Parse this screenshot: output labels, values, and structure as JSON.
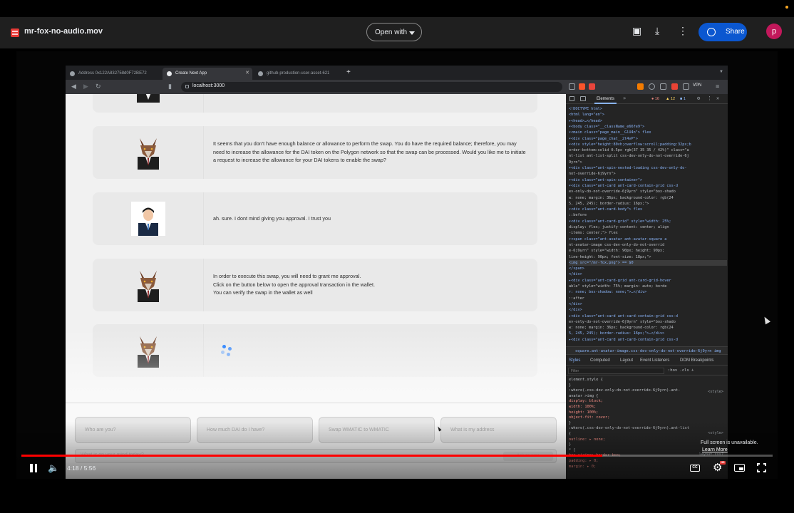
{
  "topbar": {
    "file_name": "mr-fox-no-audio.mov",
    "open_with_label": "Open with",
    "share_label": "Share",
    "avatar_letter": "p"
  },
  "browser": {
    "tabs": [
      {
        "label": "Address 0x122A832758d0F72BE72",
        "active": false
      },
      {
        "label": "Create Next App",
        "active": true
      },
      {
        "label": "github-production-user-asset-621",
        "active": false
      }
    ],
    "new_tab_label": "+",
    "url": "localhost:3000",
    "vpn_label": "VPN"
  },
  "chat": {
    "messages": [
      {
        "role": "assistant",
        "avatar": "fox-avatar",
        "text": ""
      },
      {
        "role": "assistant",
        "avatar": "fox-avatar",
        "text": "It seems that you don't have enough balance or allowance to perform the swap. You do have the required balance; therefore, you may need to increase the allowance for the DAI token on the Polygon network so that the swap can be processed. Would you like me to initiate a request to increase the allowance for your DAI tokens to enable the swap?"
      },
      {
        "role": "user",
        "avatar": "user-avatar",
        "text": "ah. sure. I dont mind giving you approval. I trust you"
      },
      {
        "role": "assistant",
        "avatar": "fox-avatar",
        "text": "In order to execute this swap, you will need to grant me approval.\nClick on the button below to open the approval transaction in the wallet.\nYou can verify the swap in the wallet as well"
      },
      {
        "role": "assistant",
        "avatar": "fox-avatar",
        "text": "",
        "loading": true
      }
    ],
    "suggestions": [
      "Who are you?",
      "How much DAI do I have?",
      "Swap WMATIC to WMATIC",
      "What is my address"
    ],
    "input_placeholder": "What is on your mind today?",
    "send_label": "Ask an area"
  },
  "devtools": {
    "tab_elements": "Elements",
    "errors": "16",
    "warnings": "12",
    "info": "1",
    "dom_lines": [
      "<!DOCTYPE html>",
      "<html lang=\"en\">",
      "▸<head>…</head>",
      "▾<body class=\"__className_e66fe9\">",
      "  ▾<main class=\"page_main__GlU4n\"> flex",
      "    ▾<div class=\"page_chat__2t4vP\">",
      "      ▾<div style=\"height:80vh;overflow:scroll;padding:32px;b",
      "        order-bottom:solid 0.5px rgb(37 35 35 / 42%)\" class=\"a",
      "        nt-list ant-list-split css-dev-only-do-not-override-6j",
      "        9yrn\">",
      "        ▾<div class=\"ant-spin-nested-loading css-dev-only-do-",
      "          not-override-6j9yrn\">",
      "          ▾<div class=\"ant-spin-container\">",
      "            ▾<div class=\"ant-card ant-card-contain-grid css-d",
      "              ev-only-do-not-override-6j9yrn\" style=\"box-shado",
      "              w: none; margin: 36px; background-color: rgb(24",
      "              5, 245, 245); border-radius: 16px;\">",
      "              ▾<div class=\"ant-card-body\"> flex",
      "                ::before",
      "              ▾<div class=\"ant-card-grid\" style=\"width: 25%;",
      "                display: flex; justify-content: center; align",
      "                -items: center;\"> flex",
      "                ▾<span class=\"ant-avatar ant-avatar-square a",
      "                  nt-avatar-image css-dev-only-do-not-overrid",
      "                  e-6j9yrn\" style=\"width: 90px; height: 90px;",
      "                  line-height: 90px; font-size: 18px;\">",
      "                    <img src=\"/mr-fox.png\"> == $0",
      "                  </span>",
      "                </div>",
      "              ▸<div class=\"ant-card-grid ant-card-grid-hover",
      "                able\" style=\"width: 75%; margin: auto; borde",
      "                r: none; box-shadow: none;\">…</div>",
      "                ::after",
      "              </div>",
      "            </div>",
      "            ▸<div class=\"ant-card ant-card-contain-grid css-d",
      "              ev-only-do-not-override-6j9yrn\" style=\"box-shado",
      "              w: none; margin: 36px; background-color: rgb(24",
      "              5, 245, 245); border-radius: 16px;\">…</div>",
      "            ▸<div class=\"ant-card ant-card-contain-grid css-d"
    ],
    "breadcrumb": "square.ant-avatar-image.css-dev-only-do-not-override-6j9yrn   img",
    "subtabs": [
      "Styles",
      "Computed",
      "Layout",
      "Event Listeners",
      "DOM Breakpoints"
    ],
    "filter_placeholder": "Filter",
    "hov_cls": ":hov  .cls  +",
    "css_lines": [
      "element.style {",
      "}",
      ":where(.css-dev-only-do-not-override-6j9yrn).ant-",
      "avatar >img {",
      "  display: block;",
      "  width: 100%;",
      "  height: 100%;",
      "  object-fit: cover;",
      "}",
      ":where(.css-dev-only-do-not-override-6j9yrn).ant-list",
      " {",
      "  outline: ▸ none;",
      "}",
      "* {",
      "  box-sizing: border-box;",
      "  padding: ▸ 0;",
      "  margin: ▸ 0;"
    ],
    "css_sources": [
      "<style>",
      "<style>",
      "layout.css?"
    ]
  },
  "player": {
    "time": "4:18 / 5:56",
    "progress_fraction": 0.7736,
    "buffer_fraction": 0.0,
    "cc_label": "CC",
    "hd_label": "HD",
    "fullscreen_msg": "Full screen is unavailable.",
    "learn_more": "Learn More"
  },
  "colors": {
    "accent": "#0b57d0",
    "progress": "#ff0000",
    "avatar": "#c2185b"
  }
}
